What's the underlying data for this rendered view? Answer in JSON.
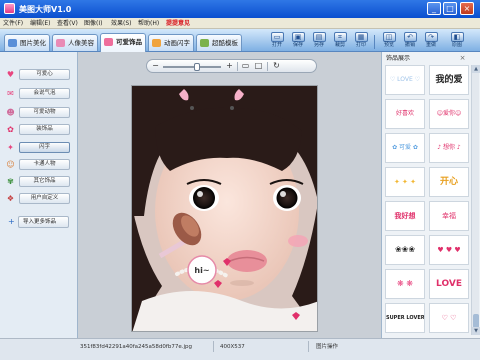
{
  "window": {
    "title": "美图大师V1.0",
    "min_glyph": "_",
    "max_glyph": "□",
    "close_glyph": "×"
  },
  "menu": {
    "items": [
      "文件(F)",
      "编辑(E)",
      "查看(V)",
      "图像(I)",
      "效果(S)",
      "帮助(H)"
    ],
    "feedback": "提提意见"
  },
  "tabs": [
    {
      "label": "图片美化",
      "icon": "image-icon",
      "color": "#5a8fd8"
    },
    {
      "label": "人像美容",
      "icon": "person-icon",
      "color": "#e98bb6"
    },
    {
      "label": "可爱饰品",
      "icon": "bow-icon",
      "color": "#ef6e9c",
      "active": true
    },
    {
      "label": "动画闪字",
      "icon": "animation-icon",
      "color": "#f0a33c"
    },
    {
      "label": "超酷模板",
      "icon": "template-icon",
      "color": "#7cb24b"
    }
  ],
  "toolbar": {
    "buttons": [
      {
        "label": "打开",
        "icon": "open-folder-icon",
        "glyph": "▭"
      },
      {
        "label": "保存",
        "icon": "save-icon",
        "glyph": "▣"
      },
      {
        "label": "另存",
        "icon": "save-as-icon",
        "glyph": "▤"
      },
      {
        "label": "裁剪",
        "icon": "crop-icon",
        "glyph": "⌗"
      },
      {
        "label": "打印",
        "icon": "print-icon",
        "glyph": "▦"
      },
      {
        "label": "预览",
        "icon": "preview-icon",
        "glyph": "◫"
      },
      {
        "label": "撤销",
        "icon": "undo-icon",
        "glyph": "↶"
      },
      {
        "label": "重做",
        "icon": "redo-icon",
        "glyph": "↷"
      },
      {
        "label": "原图",
        "icon": "original-image-icon",
        "glyph": "◧"
      }
    ]
  },
  "sidebar": {
    "items": [
      {
        "label": "可爱心",
        "icon": "heart-icon",
        "glyph": "♥",
        "color": "#e8457f"
      },
      {
        "label": "会说气泡",
        "icon": "speech-bubble-icon",
        "glyph": "✉",
        "color": "#e8457f"
      },
      {
        "label": "可爱动物",
        "icon": "animal-icon",
        "glyph": "☻",
        "color": "#d06a9a"
      },
      {
        "label": "装饰品",
        "icon": "bow-icon",
        "glyph": "✿",
        "color": "#e0306a"
      },
      {
        "label": "闪字",
        "icon": "sparkle-text-icon",
        "glyph": "✦",
        "color": "#e8457f",
        "active": true
      },
      {
        "label": "卡通人物",
        "icon": "cartoon-icon",
        "glyph": "☺",
        "color": "#d87b32"
      },
      {
        "label": "其它饰品",
        "icon": "misc-icon",
        "glyph": "✾",
        "color": "#3a8e3a"
      },
      {
        "label": "用户自定义",
        "icon": "custom-icon",
        "glyph": "❖",
        "color": "#c33a3a"
      }
    ],
    "import_label": "导入更多饰品",
    "import_glyph": "+"
  },
  "zoom": {
    "minus_glyph": "−",
    "plus_glyph": "+",
    "fit_glyph": "▭",
    "actual_glyph": "□",
    "rotate_glyph": "↻",
    "level": 0.6
  },
  "photo": {
    "sticker_text": "hi~"
  },
  "right_panel": {
    "title": "饰品展示",
    "close_glyph": "×",
    "scroll_up": "▲",
    "scroll_down": "▼",
    "thumbs": [
      {
        "text": "♡ LOVE ♡",
        "color": "#9fc3e8"
      },
      {
        "text": "我的爱",
        "color": "#222222"
      },
      {
        "text": "好喜欢",
        "color": "#e0306a"
      },
      {
        "text": "☺爱你☺",
        "color": "#e0306a"
      },
      {
        "text": "✿ 可爱 ✿",
        "color": "#5aa0e0"
      },
      {
        "text": "♪ 想你 ♪",
        "color": "#e0306a"
      },
      {
        "text": "✦ ✦ ✦",
        "color": "#f2b733"
      },
      {
        "text": "开心",
        "color": "#e8a020"
      },
      {
        "text": "我好想",
        "color": "#e0306a"
      },
      {
        "text": "幸福",
        "color": "#e0306a"
      },
      {
        "text": "❀❀❀",
        "color": "#222222"
      },
      {
        "text": "♥ ♥ ♥",
        "color": "#e0306a"
      },
      {
        "text": "❋ ❋",
        "color": "#e8457f"
      },
      {
        "text": "LOVE",
        "color": "#e0306a"
      },
      {
        "text": "SUPER LOVERS",
        "color": "#222222"
      },
      {
        "text": "♡ ♡",
        "color": "#e0306a"
      }
    ]
  },
  "statusbar": {
    "filename": "351f83fd42291a40fa245a58d0fb77e.jpg",
    "dimensions": "400X537",
    "mode": "图片操作"
  }
}
